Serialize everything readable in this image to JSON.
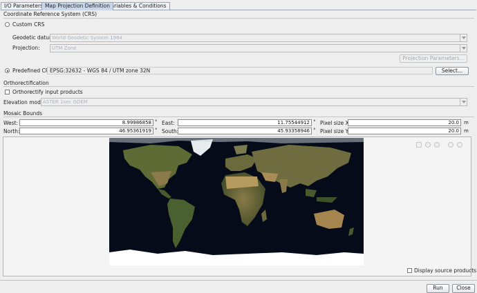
{
  "tabs": [
    {
      "label": "I/O Parameters"
    },
    {
      "label": "Map Projection Definition"
    },
    {
      "label": "Variables & Conditions"
    }
  ],
  "crs": {
    "title": "Coordinate Reference System (CRS)",
    "custom_label": "Custom CRS",
    "geodetic_label": "Geodetic datum:",
    "geodetic_value": "World Geodetic System 1984",
    "projection_label": "Projection:",
    "projection_value": "UTM Zone",
    "proj_params_button": "Projection Parameters...",
    "predefined_label": "Predefined CRS",
    "predefined_value": "EPSG:32632 - WGS 84 / UTM zone 32N",
    "select_button": "Select...",
    "custom_selected": false,
    "predefined_selected": true
  },
  "ortho": {
    "title": "Orthorectification",
    "checkbox_label": "Orthorectify input products",
    "checked": false,
    "elevation_label": "Elevation model:",
    "elevation_value": "ASTER 1sec GDEM"
  },
  "mosaic": {
    "title": "Mosaic Bounds",
    "west_label": "West:",
    "west_value": "8.99986858",
    "east_label": "East:",
    "east_value": "11.75544912",
    "north_label": "North:",
    "north_value": "46.95361919",
    "south_label": "South:",
    "south_value": "45.93358946",
    "degree": "°",
    "pixel_x_label": "Pixel size X:",
    "pixel_x_value": "20.0",
    "pixel_y_label": "Pixel size Y:",
    "pixel_y_value": "20.0",
    "unit": "m"
  },
  "display_source_label": "Display source products",
  "display_source_checked": false,
  "buttons": {
    "run": "Run",
    "close": "Close"
  },
  "colors": {
    "active_tab": "#c8d8ea",
    "ocean": "#050b18",
    "land": "#6b6a3c",
    "ice": "#ffffff"
  },
  "nav_icons": [
    "zoom-all-icon",
    "zoom-in-icon",
    "zoom-out-icon",
    "zoom-pixel-icon",
    "rotate-icon"
  ]
}
